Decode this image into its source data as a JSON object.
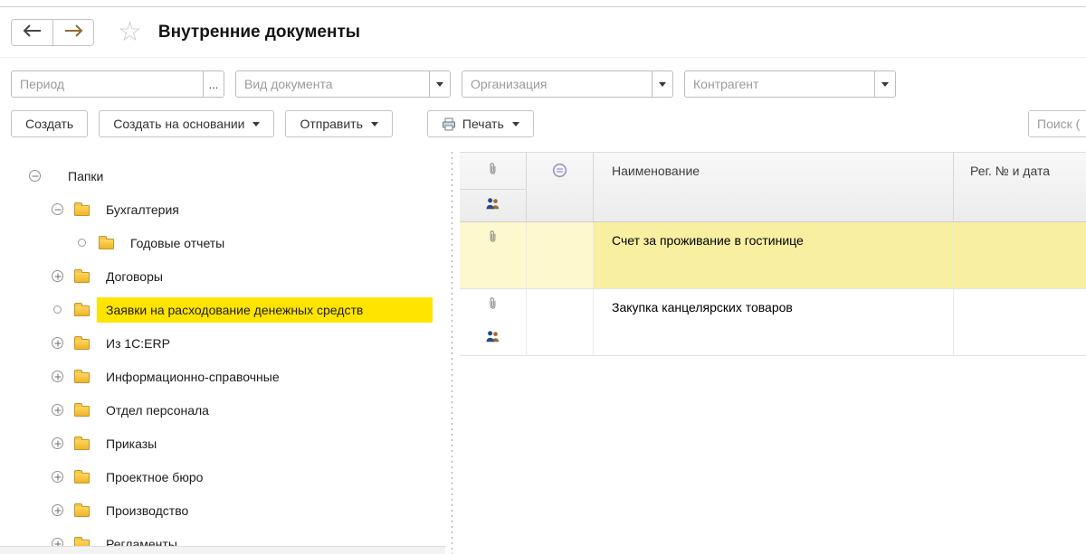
{
  "window": {
    "title": "Внутренние документы"
  },
  "icons": {
    "favorites_star": "☆",
    "back": "left-arrow",
    "forward": "right-arrow",
    "print": "printer",
    "attachment": "paperclip",
    "responsible": "two-people",
    "state": "circled-lines"
  },
  "filters": {
    "period": {
      "placeholder": "Период",
      "browse": "..."
    },
    "document_type": {
      "placeholder": "Вид документа"
    },
    "organization": {
      "placeholder": "Организация"
    },
    "counterparty": {
      "placeholder": "Контрагент"
    }
  },
  "toolbar": {
    "create": "Создать",
    "create_based_on": "Создать на основании",
    "send": "Отправить",
    "print": "Печать",
    "search_placeholder": "Поиск ("
  },
  "tree": {
    "root": {
      "label": "Папки",
      "state": "minus"
    },
    "items": [
      {
        "label": "Бухгалтерия",
        "state": "minus",
        "selected": false
      },
      {
        "label": "Годовые отчеты",
        "state": "circle",
        "selected": false
      },
      {
        "label": "Договоры",
        "state": "plus",
        "selected": false
      },
      {
        "label": "Заявки на расходование денежных средств",
        "state": "circle",
        "selected": true
      },
      {
        "label": "Из 1С:ERP",
        "state": "plus",
        "selected": false
      },
      {
        "label": "Информационно-справочные",
        "state": "plus",
        "selected": false
      },
      {
        "label": "Отдел персонала",
        "state": "plus",
        "selected": false
      },
      {
        "label": "Приказы",
        "state": "plus",
        "selected": false
      },
      {
        "label": "Проектное бюро",
        "state": "plus",
        "selected": false
      },
      {
        "label": "Производство",
        "state": "plus",
        "selected": false
      },
      {
        "label": "Регламенты",
        "state": "plus",
        "selected": false
      }
    ]
  },
  "table": {
    "headers": {
      "name": "Наименование",
      "reg": "Рег. № и дата"
    },
    "rows": [
      {
        "name": "Счет за проживание в гостинице",
        "selected": true,
        "attachment": true,
        "people": false
      },
      {
        "name": "Закупка канцелярских товаров",
        "selected": false,
        "attachment": true,
        "people": true
      }
    ]
  },
  "colors": {
    "tree_selection": "#ffe400",
    "row_selection_strong": "#f8efa1",
    "row_selection_pale": "#fdf8cd",
    "folder": "#f0b429"
  }
}
